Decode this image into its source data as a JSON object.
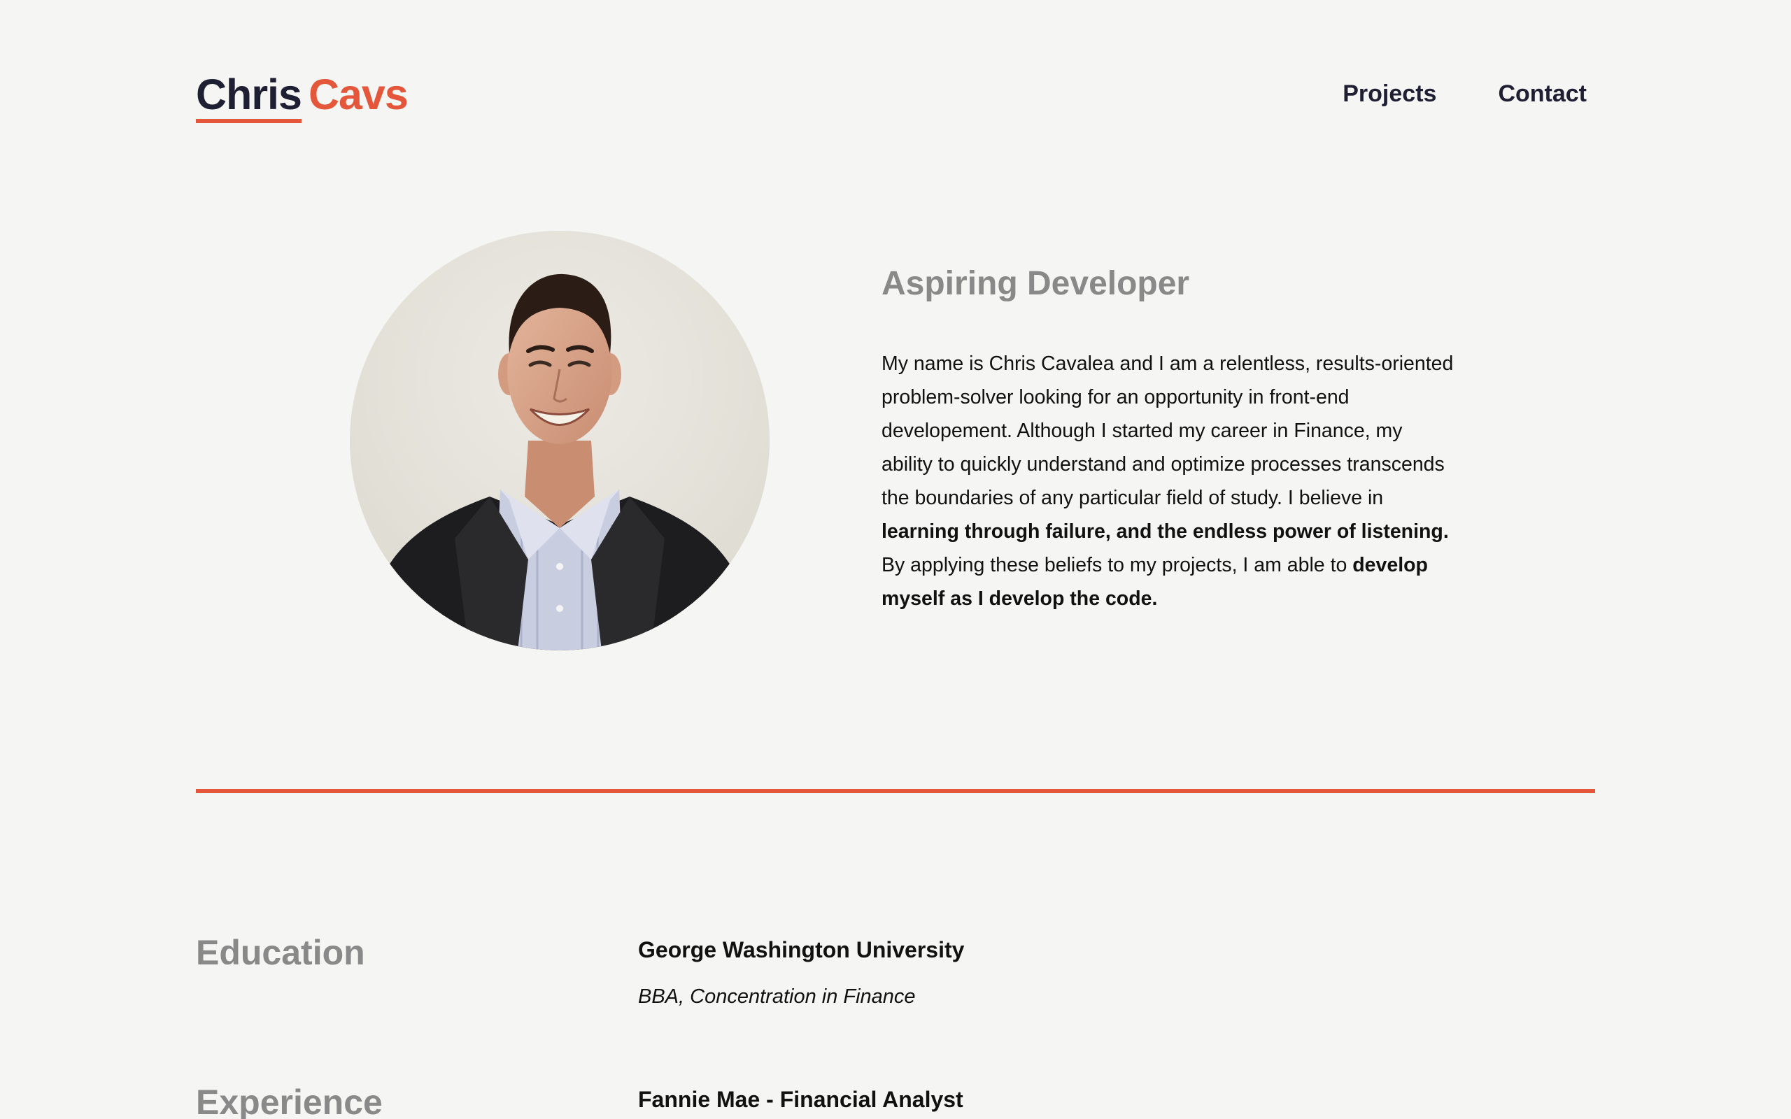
{
  "header": {
    "logo_first": "Chris",
    "logo_last": "Cavs",
    "nav": [
      {
        "label": "Projects"
      },
      {
        "label": "Contact"
      }
    ]
  },
  "hero": {
    "title": "Aspiring Developer",
    "bio_parts": [
      "My name is Chris Cavalea and I am a relentless, results-oriented problem-solver looking for an opportunity in front-end developement. Although I started my career in Finance, my ability to quickly understand and optimize processes transcends the boundaries of any particular field of study. I believe in ",
      "learning through failure, and the endless power of listening.",
      " By applying these beliefs to my projects, I am able to ",
      "develop myself as I develop the code."
    ]
  },
  "education": {
    "label": "Education",
    "school": "George Washington University",
    "degree": "BBA, Concentration in Finance"
  },
  "experience": {
    "label": "Experience",
    "role": "Fannie Mae - Financial Analyst"
  },
  "colors": {
    "accent": "#e4573b",
    "dark": "#1f1f33",
    "muted": "#898989",
    "background": "#f5f5f3"
  }
}
